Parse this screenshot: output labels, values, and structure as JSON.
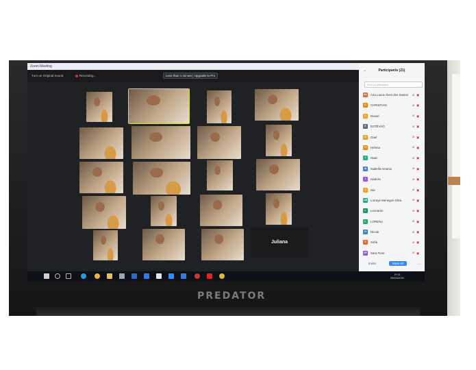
{
  "window": {
    "title": "Zoom Meeting",
    "sound_button": "Turn on Original Sound",
    "recording_label": "Recording...",
    "upgrade_banner": "Less than 1 minute | Upgrade to Pro"
  },
  "gallery": {
    "name_tile_label": "Juliana"
  },
  "participants_panel": {
    "title": "Participants (21)",
    "search_placeholder": "Find a participant",
    "items": [
      {
        "initials": "AL",
        "name": "Ana Laura Alves dos Santos",
        "color": "#e06a3b"
      },
      {
        "initials": "C",
        "name": "CHRISTIAN",
        "color": "#e08a2b"
      },
      {
        "initials": "D",
        "name": "Daniel",
        "color": "#e8a23a"
      },
      {
        "initials": "E",
        "name": "ESTÊVÃO",
        "color": "#5b6b7c"
      },
      {
        "initials": "G",
        "name": "Gael",
        "color": "#e6a12d"
      },
      {
        "initials": "H",
        "name": "Helena",
        "color": "#e38d2f"
      },
      {
        "initials": "I",
        "name": "Isaac",
        "color": "#2bb07f"
      },
      {
        "initials": "IA",
        "name": "Isabella Antonio",
        "color": "#3f7fd4"
      },
      {
        "initials": "I",
        "name": "Isadora",
        "color": "#9a5ccf"
      },
      {
        "initials": "I",
        "name": "Isis",
        "color": "#e9a23b"
      },
      {
        "initials": "LM",
        "name": "Lorraye Menegon Silva",
        "color": "#2aa68f"
      },
      {
        "initials": "L",
        "name": "Leonardo",
        "color": "#2e8f5e"
      },
      {
        "initials": "L",
        "name": "LORENA",
        "color": "#38a169"
      },
      {
        "initials": "N",
        "name": "Nicole",
        "color": "#3b82c4"
      },
      {
        "initials": "S",
        "name": "Sofia",
        "color": "#e06a3b"
      },
      {
        "initials": "SF",
        "name": "Sara Fiore",
        "color": "#8a5cc9"
      }
    ],
    "invite_label": "Invite",
    "mute_all_label": "Mute All",
    "more_label": "..."
  },
  "taskbar": {
    "time": "19:11",
    "date": "06/04/2021"
  },
  "laptop": {
    "brand": "PREDATOR"
  }
}
